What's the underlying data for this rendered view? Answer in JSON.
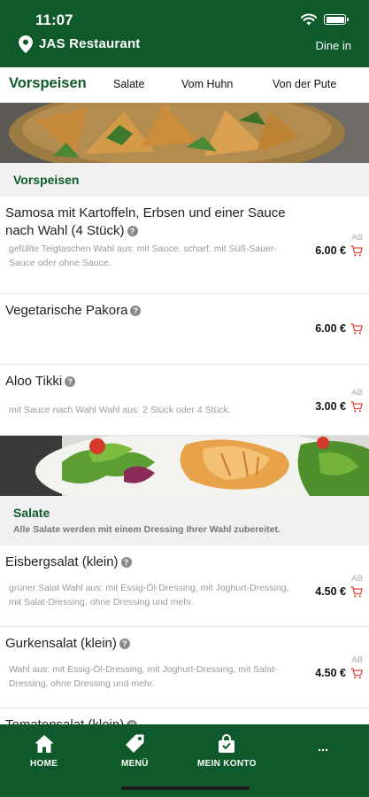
{
  "status": {
    "time": "11:07"
  },
  "header": {
    "restaurant": "JAS Restaurant",
    "mode": "Dine in"
  },
  "tabs": [
    {
      "label": "Vorspeisen"
    },
    {
      "label": "Salate"
    },
    {
      "label": "Vom Huhn"
    },
    {
      "label": "Von der Pute"
    }
  ],
  "sections": [
    {
      "title": "Vorspeisen",
      "items": [
        {
          "name": "Samosa mit Kartoffeln, Erbsen und einer Sauce nach Wahl (4 Stück)",
          "desc": "gefüllte Teigtaschen Wahl aus: mit Sauce, scharf, mit Süß-Sauer-Sauce oder ohne Sauce.",
          "ab": "AB",
          "price": "6.00 €"
        },
        {
          "name": "Vegetarische Pakora",
          "desc": "",
          "ab": "",
          "price": "6.00 €"
        },
        {
          "name": "Aloo Tikki",
          "desc": "mit Sauce nach Wahl Wahl aus: 2 Stück oder 4 Stück.",
          "ab": "AB",
          "price": "3.00 €"
        }
      ]
    },
    {
      "title": "Salate",
      "subtitle": "Alle Salate werden mit einem Dressing Ihrer Wahl zubereitet.",
      "items": [
        {
          "name": "Eisbergsalat (klein)",
          "desc": "grüner Salat Wahl aus: mit Essig-Öl-Dressing, mit Joghurt-Dressing, mit Salat-Dressing, ohne Dressing und mehr.",
          "ab": "AB",
          "price": "4.50 €"
        },
        {
          "name": "Gurkensalat (klein)",
          "desc": "Wahl aus: mit Essig-Öl-Dressing, mit Joghurt-Dressing, mit Salat-Dressing, ohne Dressing und mehr.",
          "ab": "AB",
          "price": "4.50 €"
        },
        {
          "name": "Tomatensalat (klein)",
          "desc": "",
          "ab": "",
          "price": ""
        }
      ]
    }
  ],
  "nav": [
    {
      "label": "HOME",
      "icon": "home-icon"
    },
    {
      "label": "MENÜ",
      "icon": "tag-icon"
    },
    {
      "label": "MEIN KONTO",
      "icon": "bag-icon"
    },
    {
      "label": "",
      "icon": "more-icon"
    }
  ],
  "colors": {
    "primary": "#0e5a2b",
    "cart": "#e0443a"
  }
}
